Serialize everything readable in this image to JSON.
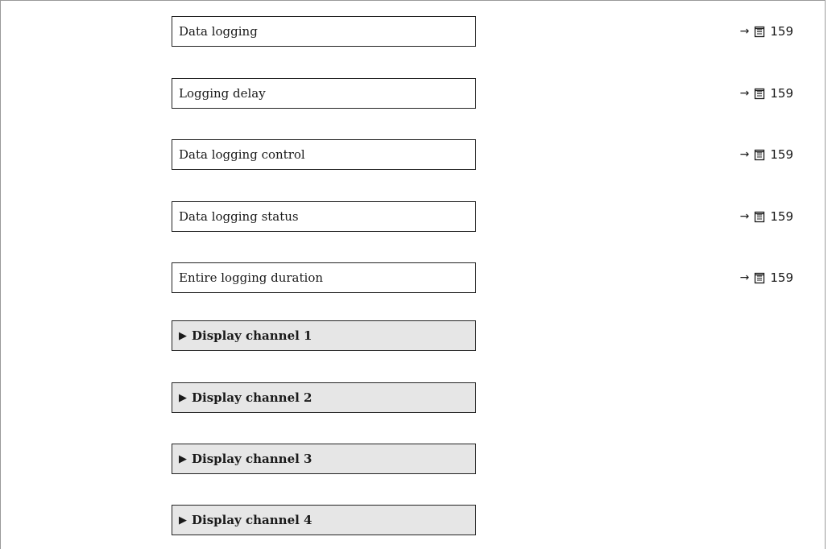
{
  "parameters": [
    {
      "label": "Data logging",
      "ref_arrow": "→",
      "ref_page": "159"
    },
    {
      "label": "Logging delay",
      "ref_arrow": "→",
      "ref_page": "159"
    },
    {
      "label": "Data logging control",
      "ref_arrow": "→",
      "ref_page": "159"
    },
    {
      "label": "Data logging status",
      "ref_arrow": "→",
      "ref_page": "159"
    },
    {
      "label": "Entire logging duration",
      "ref_arrow": "→",
      "ref_page": "159"
    }
  ],
  "submenus": [
    {
      "marker": "▶",
      "label": "Display channel 1"
    },
    {
      "marker": "▶",
      "label": "Display channel 2"
    },
    {
      "marker": "▶",
      "label": "Display channel 3"
    },
    {
      "marker": "▶",
      "label": "Display channel 4"
    }
  ],
  "icons": {
    "ref_icon": "book-page-icon"
  }
}
